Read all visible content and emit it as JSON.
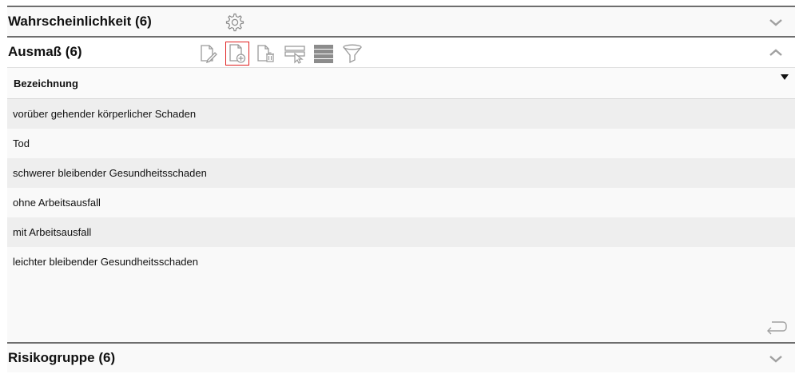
{
  "panels": [
    {
      "title": "Wahrscheinlichkeit (6)",
      "expanded": false,
      "icon": "chevron-down-icon"
    },
    {
      "title": "Ausmaß (6)",
      "expanded": true,
      "icon": "chevron-up-icon"
    },
    {
      "title": "Risikogruppe (6)",
      "expanded": false,
      "icon": "chevron-down-icon"
    }
  ],
  "toolbar": {
    "icons": [
      "edit-document-icon",
      "add-document-icon",
      "delete-document-icon",
      "select-columns-icon",
      "list-view-icon",
      "filter-icon"
    ],
    "active": "add-document-icon"
  },
  "grid": {
    "column": "Bezeichnung",
    "sort": "descending",
    "rows": [
      "vorüber gehender körperlicher Schaden",
      "Tod",
      "schwerer bleibender Gesundheitsschaden",
      "ohne Arbeitsausfall",
      "mit Arbeitsausfall",
      "leichter bleibender Gesundheitsschaden"
    ]
  },
  "colors": {
    "active_border": "#e02020",
    "icon_gray": "#9a9a9a",
    "row_alt": "#eeeeee"
  }
}
